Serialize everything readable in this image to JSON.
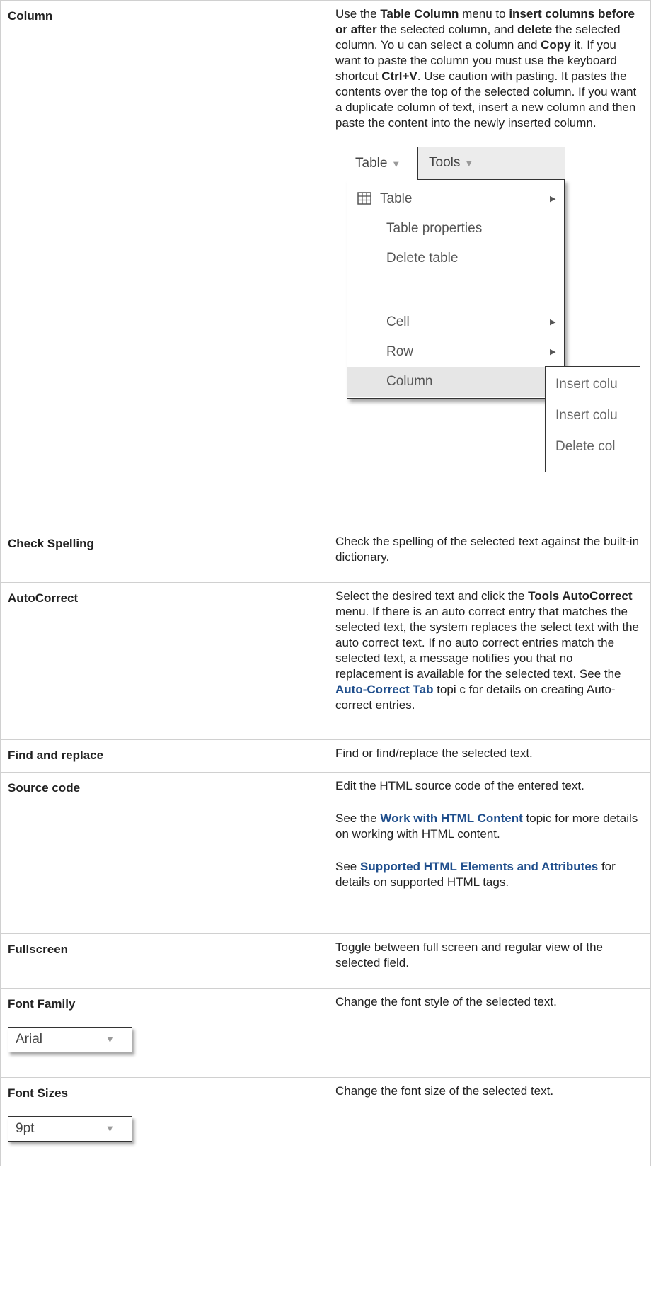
{
  "rows": {
    "column": {
      "name": "Column",
      "desc": {
        "t1": "Use the ",
        "b1": "Table  Column",
        "t2": " menu to ",
        "b2": "insert columns before or after",
        "t3": " the selected column, and ",
        "b3": "delete",
        "t4": " the selected column. Yo u can select a column and ",
        "b4": "Copy",
        "t5": " it. If you want to paste the column you must use the keyboard shortcut ",
        "b5": "Ctrl+V",
        "t6": ". Use caution with pasting. It pastes the contents over the top of the selected column. If you want a duplicate column of text, insert a new column and then paste the content into the newly inserted column."
      }
    },
    "check_spelling": {
      "name": "Check Spelling",
      "desc": "Check the spelling of the selected text against the built-in dictionary."
    },
    "autocorrect": {
      "name": "AutoCorrect",
      "t1": "Select the desired text and click the ",
      "b1": "Tools AutoCorrect",
      "t2": " menu. If there is an auto correct entry that matches the selected text, the system replaces the select text with the auto correct text. If no auto correct entries match the selected text, a message notifies you that no replacement is available for the selected text. See the ",
      "link": "Auto-Correct Tab",
      "t3": " topi c for details on creating Auto-correct entries."
    },
    "find_replace": {
      "name": "Find and replace",
      "desc": "Find or find/replace the selected text."
    },
    "source_code": {
      "name": "Source code",
      "p1": "Edit the HTML source code of the entered text.",
      "p2_t1": "See the ",
      "p2_link": "Work with HTML Content",
      "p2_t2": " topic for more details on working with HTML content.",
      "p3_t1": "See ",
      "p3_link": "Supported HTML Elements and Attributes",
      "p3_t2": " for details on supported HTML tags."
    },
    "fullscreen": {
      "name": "Fullscreen",
      "desc": "Toggle between full screen and regular view of the selected field."
    },
    "font_family": {
      "name": "Font Family",
      "desc": "Change the font style of the selected text.",
      "select_value": "Arial"
    },
    "font_sizes": {
      "name": "Font Sizes",
      "desc": "Change the font size of the selected text.",
      "select_value": "9pt"
    }
  },
  "menu": {
    "tab_table": "Table",
    "tab_tools": "Tools",
    "items": {
      "table": "Table",
      "table_properties": "Table properties",
      "delete_table": "Delete table",
      "cell": "Cell",
      "row": "Row",
      "column": "Column"
    },
    "submenu": {
      "insert_before": "Insert colu",
      "insert_after": "Insert colu",
      "delete": "Delete col"
    }
  }
}
